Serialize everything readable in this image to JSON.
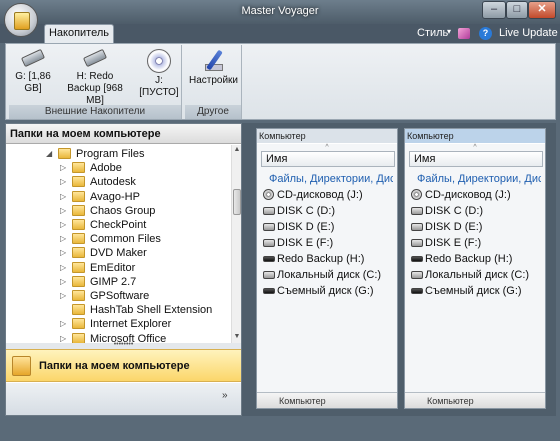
{
  "window": {
    "title": "Master Voyager",
    "min": "–",
    "max": "□",
    "close": "✕"
  },
  "tabs": {
    "storage": "Накопитель"
  },
  "topbar": {
    "style_menu": "Стиль",
    "style_arrow": "▾",
    "help": "?",
    "live_update": "Live Update"
  },
  "ribbon": {
    "external_group": "Внешние Накопители",
    "other_group": "Другое",
    "items": [
      {
        "label": "G: [1,86 GB]",
        "icon": "usb-drive-icon"
      },
      {
        "label": "H: Redo Backup [968 MB]",
        "icon": "usb-drive-icon"
      },
      {
        "label": "J: [ПУСТО]",
        "icon": "cd-drive-icon"
      }
    ],
    "settings_label": "Настройки",
    "settings_icon": "settings-pen-icon"
  },
  "left_pane": {
    "header": "Папки на моем компьютере",
    "tree": [
      {
        "label": "Program Files",
        "exp": "◢",
        "level": 0
      },
      {
        "label": "Adobe",
        "exp": "▷",
        "level": 1
      },
      {
        "label": "Autodesk",
        "exp": "▷",
        "level": 1
      },
      {
        "label": "Avago-HP",
        "exp": "▷",
        "level": 1
      },
      {
        "label": "Chaos Group",
        "exp": "▷",
        "level": 1
      },
      {
        "label": "CheckPoint",
        "exp": "▷",
        "level": 1
      },
      {
        "label": "Common Files",
        "exp": "▷",
        "level": 1
      },
      {
        "label": "DVD Maker",
        "exp": "▷",
        "level": 1
      },
      {
        "label": "EmEditor",
        "exp": "▷",
        "level": 1
      },
      {
        "label": "GIMP 2.7",
        "exp": "▷",
        "level": 1
      },
      {
        "label": "GPSoftware",
        "exp": "▷",
        "level": 1
      },
      {
        "label": "HashTab Shell Extension",
        "exp": "",
        "level": 1
      },
      {
        "label": "Internet Explorer",
        "exp": "▷",
        "level": 1
      },
      {
        "label": "Microsoft Office",
        "exp": "▷",
        "level": 1
      }
    ],
    "splitter": "••••••••",
    "folders_bar": "Папки на моем компьютере",
    "more": "»"
  },
  "panels": [
    {
      "title": "Компьютер",
      "column": "Имя",
      "sort_arrow": "^",
      "group": "Файлы, Директории, Диски",
      "drives": [
        {
          "label": "CD-дисковод (J:)",
          "type": "cd"
        },
        {
          "label": "DISK C (D:)",
          "type": "hdd"
        },
        {
          "label": "DISK D (E:)",
          "type": "hdd"
        },
        {
          "label": "DISK E (F:)",
          "type": "hdd"
        },
        {
          "label": "Redo Backup (H:)",
          "type": "usb"
        },
        {
          "label": "Локальный диск (C:)",
          "type": "hdd"
        },
        {
          "label": "Съемный диск (G:)",
          "type": "usb"
        }
      ],
      "footer": "Компьютер"
    },
    {
      "title": "Компьютер",
      "column": "Имя",
      "sort_arrow": "^",
      "group": "Файлы, Директории, Диски",
      "drives": [
        {
          "label": "CD-дисковод (J:)",
          "type": "cd"
        },
        {
          "label": "DISK C (D:)",
          "type": "hdd"
        },
        {
          "label": "DISK D (E:)",
          "type": "hdd"
        },
        {
          "label": "DISK E (F:)",
          "type": "hdd"
        },
        {
          "label": "Redo Backup (H:)",
          "type": "usb"
        },
        {
          "label": "Локальный диск (C:)",
          "type": "hdd"
        },
        {
          "label": "Съемный диск (G:)",
          "type": "usb"
        }
      ],
      "footer": "Компьютер"
    }
  ]
}
